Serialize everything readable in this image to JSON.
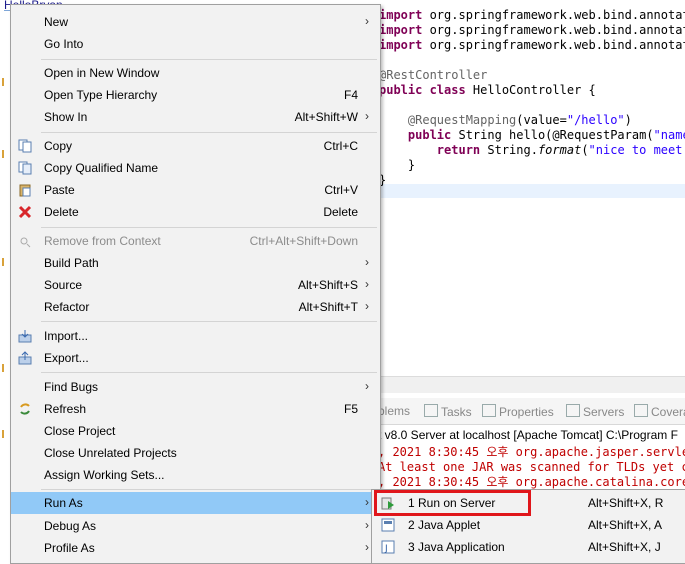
{
  "explorer": {
    "title": "HelloBryan"
  },
  "editor": {
    "lines": [
      {
        "kw": "import",
        "rest": " org.springframework.web.bind.annotati"
      },
      {
        "kw": "import",
        "rest": " org.springframework.web.bind.annotati"
      },
      {
        "kw": "import",
        "rest": " org.springframework.web.bind.annotati"
      },
      {
        "ann": "@RestController"
      },
      {
        "kw": "public class",
        "rest": " HelloController {"
      },
      {
        "ann": "    @RequestMapping",
        "rest": "(value=",
        "str": "\"/hello\"",
        "tail": ")"
      },
      {
        "kw": "    public",
        "rest": " String hello(@RequestParam(",
        "str": "\"name\""
      },
      {
        "kw": "        return",
        "rest": " String.",
        "ital": "format",
        "rest2": "(",
        "str": "\"nice to meet y"
      },
      {
        "rest": "    }"
      },
      {
        "rest": "}"
      }
    ]
  },
  "panel": {
    "tabs": [
      "blems",
      "Tasks",
      "Properties",
      "Servers",
      "Covera"
    ],
    "console_title": "t v8.0 Server at localhost [Apache Tomcat] C:\\Program F",
    "logs": [
      ", 2021 8:30:45 오후 org.apache.jasper.servlet.",
      "At least one JAR was scanned for TLDs yet co",
      ", 2021 8:30:45 오후 org.apache.catalina.core.A"
    ]
  },
  "menu": {
    "items": [
      {
        "label": "New",
        "submenu": true
      },
      {
        "label": "Go Into"
      },
      {
        "label": "Open in New Window"
      },
      {
        "label": "Open Type Hierarchy",
        "shortcut": "F4"
      },
      {
        "label": "Show In",
        "shortcut": "Alt+Shift+W",
        "submenu": true
      },
      {
        "label": "Copy",
        "shortcut": "Ctrl+C",
        "icon": "copy-icon"
      },
      {
        "label": "Copy Qualified Name",
        "icon": "copy-qualified-icon"
      },
      {
        "label": "Paste",
        "shortcut": "Ctrl+V",
        "icon": "paste-icon"
      },
      {
        "label": "Delete",
        "shortcut": "Delete",
        "icon": "delete-icon"
      },
      {
        "label": "Remove from Context",
        "shortcut": "Ctrl+Alt+Shift+Down",
        "icon": "remove-context-icon",
        "disabled": true
      },
      {
        "label": "Build Path",
        "submenu": true
      },
      {
        "label": "Source",
        "shortcut": "Alt+Shift+S",
        "submenu": true
      },
      {
        "label": "Refactor",
        "shortcut": "Alt+Shift+T",
        "submenu": true
      },
      {
        "label": "Import...",
        "icon": "import-icon"
      },
      {
        "label": "Export...",
        "icon": "export-icon"
      },
      {
        "label": "Find Bugs",
        "submenu": true
      },
      {
        "label": "Refresh",
        "shortcut": "F5",
        "icon": "refresh-icon"
      },
      {
        "label": "Close Project"
      },
      {
        "label": "Close Unrelated Projects"
      },
      {
        "label": "Assign Working Sets..."
      },
      {
        "label": "Run As",
        "submenu": true,
        "active": true
      },
      {
        "label": "Debug As",
        "submenu": true
      },
      {
        "label": "Profile As",
        "submenu": true
      }
    ]
  },
  "submenu": {
    "items": [
      {
        "label": "1 Run on Server",
        "shortcut": "Alt+Shift+X, R",
        "icon": "run-on-server-icon"
      },
      {
        "label": "2 Java Applet",
        "shortcut": "Alt+Shift+X, A",
        "icon": "java-applet-icon"
      },
      {
        "label": "3 Java Application",
        "shortcut": "Alt+Shift+X, J",
        "icon": "java-application-icon"
      }
    ]
  },
  "colors": {
    "menu_bg": "#f2f2f2",
    "active_bg": "#91c9f7",
    "highlight_border": "#e0161b",
    "keyword": "#7f0055",
    "string": "#2a00ff",
    "log_red": "#c00000"
  }
}
